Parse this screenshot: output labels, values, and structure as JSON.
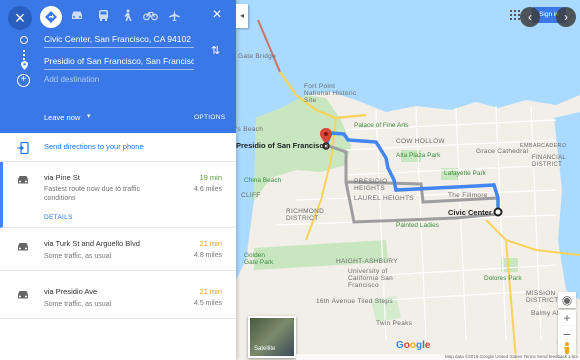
{
  "header": {
    "travel_modes": [
      "close-icon",
      "drive-icon",
      "car-icon",
      "transit-icon",
      "walk-icon",
      "bike-icon",
      "flight-icon"
    ],
    "close_label": "×",
    "origin": "Civic Center, San Francisco, CA 94102",
    "destination": "Presidio of San Francisco, San Francisco",
    "add_destination": "Add destination",
    "leave_now": "Leave now",
    "options": "OPTIONS"
  },
  "send_directions": "Send directions to your phone",
  "routes": [
    {
      "title": "via Pine St",
      "subtitle": "Fastest route now due to traffic conditions",
      "time": "19 min",
      "distance": "4.6 miles",
      "time_color": "#5a9e2f",
      "details": "DETAILS"
    },
    {
      "title": "via Turk St and Arguello Blvd",
      "subtitle": "Some traffic, as usual",
      "time": "21 min",
      "distance": "4.8 miles",
      "time_color": "#e8a317"
    },
    {
      "title": "via Presidio Ave",
      "subtitle": "Some traffic, as usual",
      "time": "21 min",
      "distance": "4.5 miles",
      "time_color": "#e8a317"
    }
  ],
  "map": {
    "sign_in": "Sign in",
    "satellite": "Satellite",
    "logo": "Google",
    "attribution": "Map data ©2018 Google  United States  Terms  Send feedback  1 km",
    "origin_label": "Civic Center",
    "destination_label": "Presidio of San Francisco",
    "labels": {
      "golden_gate_bridge": "Gate Bridge",
      "fort_point": "Fort Point National Historic Site",
      "s_beach": "'s Beach",
      "palace": "Palace of Fine Arts",
      "cow_hollow": "COW HOLLOW",
      "alta_plaza": "Alta Plaza Park",
      "grace_cathedral": "Grace Cathedral",
      "embarcadero": "EMBARCADERO",
      "lafayette": "Lafayette Park",
      "financial": "FINANCIAL DISTRICT",
      "china_beach": "China Beach",
      "presidio_heights": "PRESIDIO HEIGHTS",
      "laurel_heights": "LAUREL HEIGHTS",
      "fillmore": "The Fillmore",
      "cliff": "CLIFF",
      "richmond": "RICHMOND DISTRICT",
      "painted_ladies": "Painted Ladies",
      "golden_gate_park": "Golden Gate Park",
      "haight": "HAIGHT-ASHBURY",
      "ucsf": "University of California San Francisco",
      "dolores": "Dolores Park",
      "mission": "MISSION DISTRICT",
      "tiled_steps": "16th Avenue Tiled Steps",
      "balmy": "Balmy Alley",
      "twin_peaks": "Twin Peaks"
    }
  },
  "colors": {
    "header_blue": "#3b78e7",
    "route_primary": "#4285f4",
    "route_alt": "#9e9e9e",
    "origin_marker": "#222222",
    "destination_marker": "#db4437"
  }
}
